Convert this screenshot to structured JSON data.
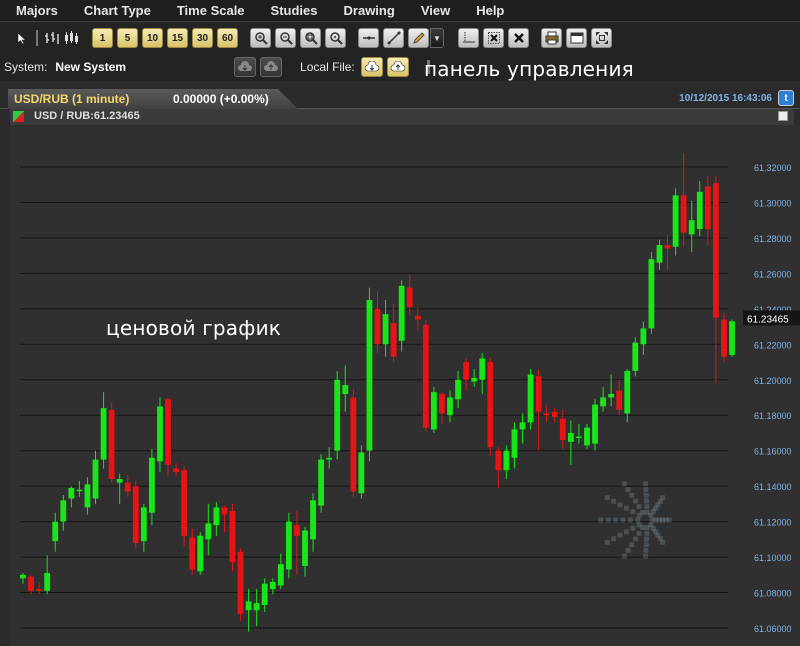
{
  "menu": {
    "items": [
      "Majors",
      "Chart Type",
      "Time Scale",
      "Studies",
      "Drawing",
      "View",
      "Help"
    ]
  },
  "toolbar": {
    "timeframes": [
      "1",
      "5",
      "10",
      "15",
      "30",
      "60"
    ]
  },
  "system": {
    "label": "System:",
    "value": "New System",
    "local_file_label": "Local File:"
  },
  "overlay": {
    "control_panel": "панель управления",
    "price_chart": "ценовой график"
  },
  "tab": {
    "title": "USD/RUB (1 minute)",
    "price_change": "0.00000 (+0.00%)",
    "datetime": "10/12/2015 16:43:06"
  },
  "symbol": {
    "label": "USD / RUB:61.23465"
  },
  "colors": {
    "up": "#19e619",
    "down": "#e61414",
    "axis_text": "#7fb2e6",
    "accent_tab": "#f5d86a"
  },
  "chart_data": {
    "type": "candlestick",
    "y_axis_ticks": [
      "61.32000",
      "61.30000",
      "61.28000",
      "61.26000",
      "61.24000",
      "61.22000",
      "61.20000",
      "61.18000",
      "61.16000",
      "61.14000",
      "61.12000",
      "61.10000",
      "61.08000",
      "61.06000"
    ],
    "ylim": [
      61.054,
      61.326
    ],
    "current_price": "61.23465",
    "candles": [
      {
        "o": 61.088,
        "h": 61.091,
        "l": 61.085,
        "c": 61.09
      },
      {
        "o": 61.089,
        "h": 61.09,
        "l": 61.079,
        "c": 61.081
      },
      {
        "o": 61.082,
        "h": 61.086,
        "l": 61.079,
        "c": 61.081
      },
      {
        "o": 61.081,
        "h": 61.101,
        "l": 61.079,
        "c": 61.091
      },
      {
        "o": 61.109,
        "h": 61.125,
        "l": 61.103,
        "c": 61.12
      },
      {
        "o": 61.12,
        "h": 61.135,
        "l": 61.115,
        "c": 61.132
      },
      {
        "o": 61.133,
        "h": 61.14,
        "l": 61.128,
        "c": 61.139
      },
      {
        "o": 61.138,
        "h": 61.143,
        "l": 61.134,
        "c": 61.138
      },
      {
        "o": 61.128,
        "h": 61.145,
        "l": 61.124,
        "c": 61.141
      },
      {
        "o": 61.133,
        "h": 61.16,
        "l": 61.13,
        "c": 61.155
      },
      {
        "o": 61.155,
        "h": 61.193,
        "l": 61.15,
        "c": 61.184
      },
      {
        "o": 61.183,
        "h": 61.187,
        "l": 61.142,
        "c": 61.144
      },
      {
        "o": 61.142,
        "h": 61.147,
        "l": 61.13,
        "c": 61.144
      },
      {
        "o": 61.142,
        "h": 61.146,
        "l": 61.134,
        "c": 61.137
      },
      {
        "o": 61.14,
        "h": 61.143,
        "l": 61.105,
        "c": 61.108
      },
      {
        "o": 61.109,
        "h": 61.13,
        "l": 61.103,
        "c": 61.128
      },
      {
        "o": 61.125,
        "h": 61.161,
        "l": 61.118,
        "c": 61.156
      },
      {
        "o": 61.154,
        "h": 61.19,
        "l": 61.148,
        "c": 61.185
      },
      {
        "o": 61.189,
        "h": 61.19,
        "l": 61.146,
        "c": 61.152
      },
      {
        "o": 61.15,
        "h": 61.153,
        "l": 61.146,
        "c": 61.148
      },
      {
        "o": 61.149,
        "h": 61.151,
        "l": 61.106,
        "c": 61.112
      },
      {
        "o": 61.111,
        "h": 61.116,
        "l": 61.09,
        "c": 61.093
      },
      {
        "o": 61.092,
        "h": 61.114,
        "l": 61.09,
        "c": 61.112
      },
      {
        "o": 61.11,
        "h": 61.13,
        "l": 61.101,
        "c": 61.119
      },
      {
        "o": 61.118,
        "h": 61.131,
        "l": 61.112,
        "c": 61.128
      },
      {
        "o": 61.128,
        "h": 61.129,
        "l": 61.114,
        "c": 61.124
      },
      {
        "o": 61.126,
        "h": 61.13,
        "l": 61.092,
        "c": 61.097
      },
      {
        "o": 61.103,
        "h": 61.105,
        "l": 61.064,
        "c": 61.068
      },
      {
        "o": 61.07,
        "h": 61.082,
        "l": 61.058,
        "c": 61.075
      },
      {
        "o": 61.07,
        "h": 61.082,
        "l": 61.061,
        "c": 61.074
      },
      {
        "o": 61.073,
        "h": 61.088,
        "l": 61.069,
        "c": 61.085
      },
      {
        "o": 61.082,
        "h": 61.088,
        "l": 61.079,
        "c": 61.086
      },
      {
        "o": 61.084,
        "h": 61.102,
        "l": 61.082,
        "c": 61.096
      },
      {
        "o": 61.093,
        "h": 61.125,
        "l": 61.088,
        "c": 61.12
      },
      {
        "o": 61.118,
        "h": 61.126,
        "l": 61.09,
        "c": 61.112
      },
      {
        "o": 61.095,
        "h": 61.117,
        "l": 61.089,
        "c": 61.115
      },
      {
        "o": 61.11,
        "h": 61.136,
        "l": 61.103,
        "c": 61.132
      },
      {
        "o": 61.129,
        "h": 61.158,
        "l": 61.125,
        "c": 61.155
      },
      {
        "o": 61.155,
        "h": 61.162,
        "l": 61.15,
        "c": 61.156
      },
      {
        "o": 61.16,
        "h": 61.205,
        "l": 61.155,
        "c": 61.2
      },
      {
        "o": 61.192,
        "h": 61.208,
        "l": 61.182,
        "c": 61.197
      },
      {
        "o": 61.19,
        "h": 61.195,
        "l": 61.134,
        "c": 61.137
      },
      {
        "o": 61.136,
        "h": 61.163,
        "l": 61.133,
        "c": 61.159
      },
      {
        "o": 61.16,
        "h": 61.252,
        "l": 61.154,
        "c": 61.245
      },
      {
        "o": 61.24,
        "h": 61.25,
        "l": 61.215,
        "c": 61.22
      },
      {
        "o": 61.22,
        "h": 61.245,
        "l": 61.213,
        "c": 61.237
      },
      {
        "o": 61.232,
        "h": 61.243,
        "l": 61.21,
        "c": 61.213
      },
      {
        "o": 61.222,
        "h": 61.256,
        "l": 61.216,
        "c": 61.253
      },
      {
        "o": 61.252,
        "h": 61.259,
        "l": 61.236,
        "c": 61.241
      },
      {
        "o": 61.236,
        "h": 61.241,
        "l": 61.228,
        "c": 61.234
      },
      {
        "o": 61.231,
        "h": 61.234,
        "l": 61.171,
        "c": 61.173
      },
      {
        "o": 61.172,
        "h": 61.196,
        "l": 61.17,
        "c": 61.193
      },
      {
        "o": 61.192,
        "h": 61.193,
        "l": 61.175,
        "c": 61.181
      },
      {
        "o": 61.18,
        "h": 61.194,
        "l": 61.176,
        "c": 61.19
      },
      {
        "o": 61.189,
        "h": 61.205,
        "l": 61.184,
        "c": 61.2
      },
      {
        "o": 61.21,
        "h": 61.212,
        "l": 61.194,
        "c": 61.2
      },
      {
        "o": 61.199,
        "h": 61.206,
        "l": 61.196,
        "c": 61.201
      },
      {
        "o": 61.2,
        "h": 61.215,
        "l": 61.192,
        "c": 61.212
      },
      {
        "o": 61.21,
        "h": 61.212,
        "l": 61.157,
        "c": 61.162
      },
      {
        "o": 61.16,
        "h": 61.162,
        "l": 61.139,
        "c": 61.149
      },
      {
        "o": 61.149,
        "h": 61.163,
        "l": 61.144,
        "c": 61.16
      },
      {
        "o": 61.156,
        "h": 61.176,
        "l": 61.15,
        "c": 61.172
      },
      {
        "o": 61.172,
        "h": 61.181,
        "l": 61.164,
        "c": 61.176
      },
      {
        "o": 61.176,
        "h": 61.206,
        "l": 61.172,
        "c": 61.203
      },
      {
        "o": 61.202,
        "h": 61.206,
        "l": 61.16,
        "c": 61.182
      },
      {
        "o": 61.181,
        "h": 61.186,
        "l": 61.176,
        "c": 61.18
      },
      {
        "o": 61.182,
        "h": 61.184,
        "l": 61.176,
        "c": 61.179
      },
      {
        "o": 61.178,
        "h": 61.183,
        "l": 61.161,
        "c": 61.166
      },
      {
        "o": 61.165,
        "h": 61.177,
        "l": 61.152,
        "c": 61.17
      },
      {
        "o": 61.168,
        "h": 61.175,
        "l": 61.164,
        "c": 61.168
      },
      {
        "o": 61.163,
        "h": 61.175,
        "l": 61.161,
        "c": 61.173
      },
      {
        "o": 61.164,
        "h": 61.189,
        "l": 61.16,
        "c": 61.186
      },
      {
        "o": 61.185,
        "h": 61.196,
        "l": 61.182,
        "c": 61.19
      },
      {
        "o": 61.19,
        "h": 61.203,
        "l": 61.185,
        "c": 61.192
      },
      {
        "o": 61.194,
        "h": 61.2,
        "l": 61.18,
        "c": 61.183
      },
      {
        "o": 61.181,
        "h": 61.206,
        "l": 61.176,
        "c": 61.205
      },
      {
        "o": 61.205,
        "h": 61.224,
        "l": 61.202,
        "c": 61.221
      },
      {
        "o": 61.22,
        "h": 61.233,
        "l": 61.214,
        "c": 61.229
      },
      {
        "o": 61.229,
        "h": 61.272,
        "l": 61.226,
        "c": 61.268
      },
      {
        "o": 61.266,
        "h": 61.279,
        "l": 61.262,
        "c": 61.276
      },
      {
        "o": 61.276,
        "h": 61.282,
        "l": 61.262,
        "c": 61.274
      },
      {
        "o": 61.275,
        "h": 61.308,
        "l": 61.27,
        "c": 61.304
      },
      {
        "o": 61.304,
        "h": 61.328,
        "l": 61.275,
        "c": 61.283
      },
      {
        "o": 61.282,
        "h": 61.301,
        "l": 61.272,
        "c": 61.29
      },
      {
        "o": 61.285,
        "h": 61.312,
        "l": 61.281,
        "c": 61.306
      },
      {
        "o": 61.309,
        "h": 61.315,
        "l": 61.276,
        "c": 61.285
      },
      {
        "o": 61.311,
        "h": 61.315,
        "l": 61.198,
        "c": 61.235
      },
      {
        "o": 61.234,
        "h": 61.238,
        "l": 61.21,
        "c": 61.213
      },
      {
        "o": 61.214,
        "h": 61.234,
        "l": 61.213,
        "c": 61.233
      }
    ]
  }
}
